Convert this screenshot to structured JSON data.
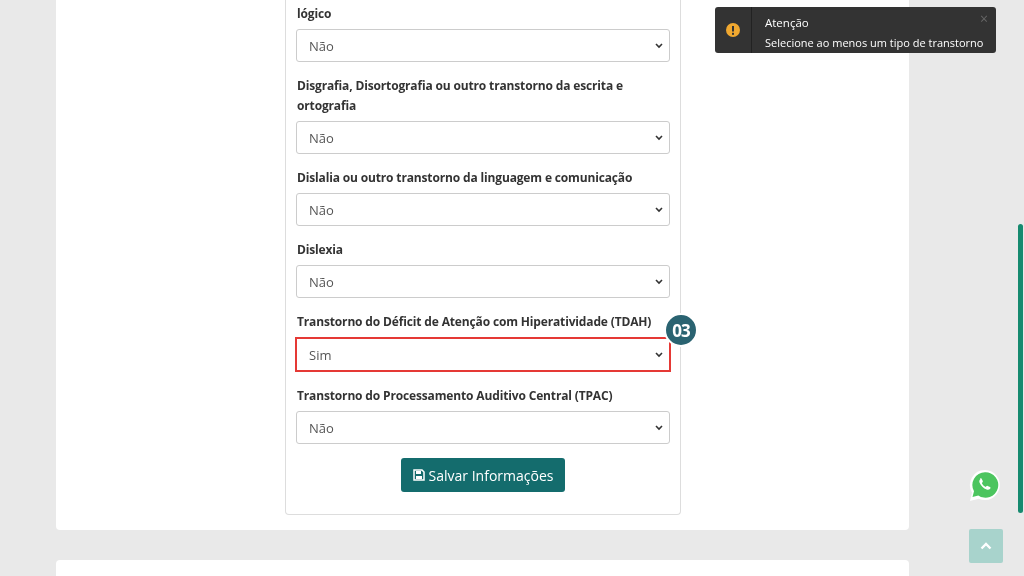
{
  "form": {
    "fields": [
      {
        "label": "lógico",
        "value": "Não",
        "highlighted": false
      },
      {
        "label": "Disgrafia, Disortografia ou outro transtorno da escrita e ortografia",
        "value": "Não",
        "highlighted": false
      },
      {
        "label": "Dislalia ou outro transtorno da linguagem e comunicação",
        "value": "Não",
        "highlighted": false
      },
      {
        "label": "Dislexia",
        "value": "Não",
        "highlighted": false
      },
      {
        "label": "Transtorno do Déficit de Atenção com Hiperatividade (TDAH)",
        "value": "Sim",
        "highlighted": true
      },
      {
        "label": "Transtorno do Processamento Auditivo Central (TPAC)",
        "value": "Não",
        "highlighted": false
      }
    ],
    "step_badge": "03",
    "submit_button": "Salvar Informações"
  },
  "toast": {
    "title": "Atenção",
    "message": "Selecione ao menos um tipo de transtorno",
    "close": "×"
  }
}
